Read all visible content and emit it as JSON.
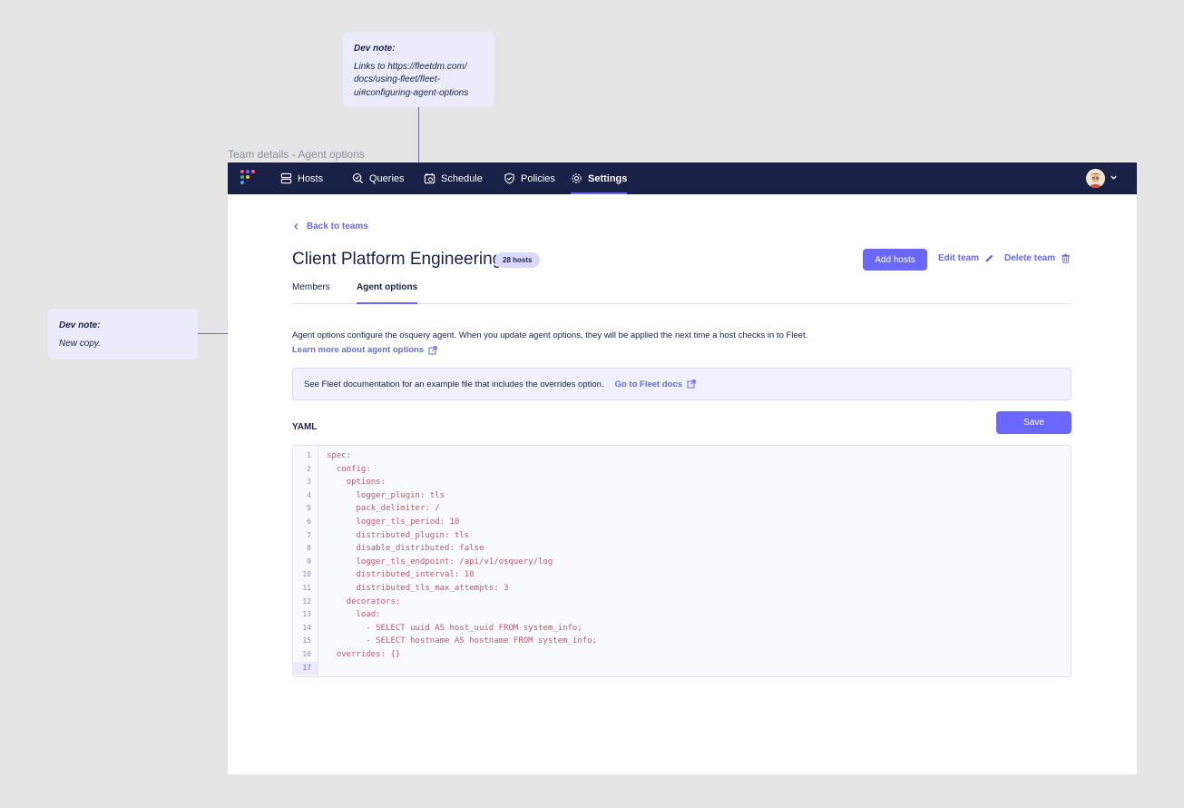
{
  "notes": {
    "top": {
      "title": "Dev note:",
      "text": "Links to https://fleetdm.com/ docs/using-fleet/fleet- ui#configuring-agent-options"
    },
    "left": {
      "title": "Dev note:",
      "text": "New copy."
    }
  },
  "frame_label": "Team details - Agent options",
  "nav": {
    "items": [
      {
        "label": "Hosts",
        "icon": "hosts-icon"
      },
      {
        "label": "Queries",
        "icon": "queries-icon"
      },
      {
        "label": "Schedule",
        "icon": "schedule-icon"
      },
      {
        "label": "Policies",
        "icon": "policies-icon"
      },
      {
        "label": "Settings",
        "icon": "settings-icon",
        "active": true
      }
    ]
  },
  "back_link": "Back to teams",
  "team": {
    "name": "Client Platform Engineering",
    "hosts_badge": "28 hosts"
  },
  "actions": {
    "add_hosts": "Add hosts",
    "edit_team": "Edit team",
    "delete_team": "Delete team"
  },
  "tabs": [
    {
      "label": "Members"
    },
    {
      "label": "Agent options",
      "active": true
    }
  ],
  "description": "Agent options configure the osquery agent. When you update agent options, they will be applied the next time a host checks in to Fleet.",
  "learn_more": "Learn more about agent options",
  "info": {
    "text": "See Fleet documentation for an example file that includes the overrides option.",
    "link": "Go to Fleet docs"
  },
  "editor": {
    "label": "YAML",
    "save": "Save",
    "lines": [
      "spec:",
      "  config:",
      "    options:",
      "      logger_plugin: tls",
      "      pack_delimiter: /",
      "      logger_tls_period: 10",
      "      distributed_plugin: tls",
      "      disable_distributed: false",
      "      logger_tls_endpoint: /api/v1/osquery/log",
      "      distributed_interval: 10",
      "      distributed_tls_max_attempts: 3",
      "    decorators:",
      "      load:",
      "        - SELECT uuid AS host_uuid FROM system_info;",
      "        - SELECT hostname AS hostname FROM system_info;",
      "  overrides: {}",
      ""
    ],
    "line_numbers": [
      "1",
      "2",
      "3",
      "4",
      "5",
      "6",
      "7",
      "8",
      "9",
      "10",
      "11",
      "12",
      "13",
      "14",
      "15",
      "16",
      "17"
    ],
    "current_line": "17"
  },
  "colors": {
    "accent": "#6a67fe",
    "nav_bg": "#192147",
    "code_text": "#c4566b"
  }
}
